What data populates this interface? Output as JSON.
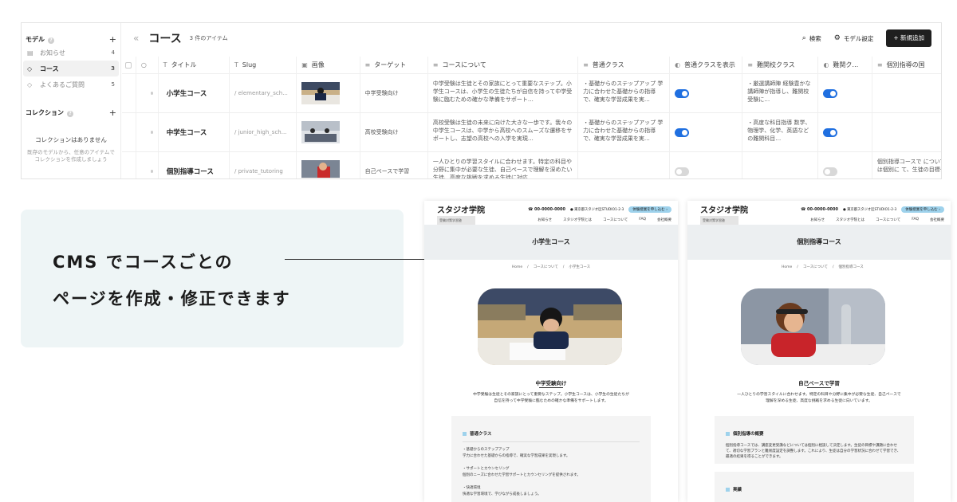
{
  "sidebar": {
    "models_label": "モデル",
    "models": [
      {
        "label": "お知らせ",
        "count": "4",
        "icon": "document-icon"
      },
      {
        "label": "コース",
        "count": "3",
        "icon": "tag-icon"
      },
      {
        "label": "よくあるご質問",
        "count": "5",
        "icon": "tag-icon"
      }
    ],
    "collections_label": "コレクション",
    "empty_title": "コレクションはありません",
    "empty_desc_1": "既存のモデルから、任意のアイテムで",
    "empty_desc_2": "コレクションを作成しましょう"
  },
  "header": {
    "back": "«",
    "title": "コース",
    "count": "3 件のアイテム",
    "search": "検索",
    "model_settings": "モデル設定",
    "new_item": "新規追加"
  },
  "table": {
    "columns": [
      "タイトル",
      "Slug",
      "画像",
      "ターゲット",
      "コースについて",
      "普通クラス",
      "普通クラスを表示",
      "難関校クラス",
      "難関ク…",
      "個別指導の国"
    ],
    "rows": [
      {
        "title": "小学生コース",
        "slug": "/ elementary_sch...",
        "target": "中学受験向け",
        "about": "中学受験は生徒とその家族にとって重要なステップ。小学生コースは、小学生の生徒たちが自信を持って中学受験に臨むための確かな準備をサポート…",
        "regular": "・基礎からのステップアップ 学力に合わせた基礎からの指導で、確実な学習成果を実…",
        "regular_show": true,
        "advanced": "・厳選講師陣 経験豊かな講師陣が指導し、難関校受験に…",
        "advanced_show": true,
        "private": ""
      },
      {
        "title": "中学生コース",
        "slug": "/ junior_high_sch...",
        "target": "高校受験向け",
        "about": "高校受験は生徒の未来に向けた大きな一歩です。我々の中学生コースは、中学から高校へのスムーズな遷移をサポートし、志望の高校への入学を実現…",
        "regular": "・基礎からのステップアップ 学力に合わせた基礎からの指導で、確実な学習成果を実…",
        "regular_show": true,
        "advanced": "・高度な科目指導 数学、物理学、化学、英語などの難関科目…",
        "advanced_show": true,
        "private": ""
      },
      {
        "title": "個別指導コース",
        "slug": "/ private_tutoring",
        "target": "自己ペースで学習",
        "about": "一人ひとりの学習スタイルに合わせます。特定の科目や分野に集中が必要な生徒、自己ペースで理解を深めたい生徒、高度な挑戦を求める生徒に対応…",
        "regular": "",
        "regular_show": false,
        "advanced": "",
        "advanced_show": false,
        "private": "個別指導コースで については個別に て、生徒の目標や"
      }
    ]
  },
  "callout": {
    "line1": "CMS でコースごとの",
    "line2": "ページを作成・修正できます"
  },
  "site": {
    "logo": "スタジオ学院",
    "logo_sub": "受験対策学習塾",
    "tel": "00-0000-0000",
    "address": "東京都スタジオ区STUDIO1-2-3",
    "cta": "体験授業を申し込む ›",
    "nav": [
      "お知らせ",
      "スタジオ学院とは",
      "コースについて",
      "FAQ",
      "会社概要"
    ],
    "crumb_home": "Home",
    "crumb_courses": "コースについて"
  },
  "preview_left": {
    "band_title": "小学生コース",
    "crumb_current": "小学生コース",
    "caption": "中学受験向け",
    "desc": "中学受験は生徒とその家族にとって重要なステップ。小学生コースは、小学生の生徒たちが自信を持って中学受験に臨むための確かな準備をサポートします。",
    "box_title": "普通クラス",
    "items": [
      {
        "h": "・基礎からのステップアップ",
        "b": "学力に合わせた基礎からの指導で、確実な学習成果を実現します。"
      },
      {
        "h": "・サポートとカウンセリング",
        "b": "個別のニーズに合わせた学習サポートとカウンセリングを提供されます。"
      },
      {
        "h": "・快適環境",
        "b": "快適な学習環境で、学びながら成長しましょう。"
      }
    ]
  },
  "preview_right": {
    "band_title": "個別指導コース",
    "crumb_current": "個別指導コース",
    "caption": "自己ペースで学習",
    "desc": "一人ひとりの学習スタイルに合わせます。特定の科目や分野に集中が必要な生徒、自己ペースで理解を深める生徒、高度な挑戦を求める生徒に向いています。",
    "box_title": "個別指導の概要",
    "box_text": "個別指導コースでは、講座変更受講などについては個別に相談して決定します。生徒の目標や課題に合わせて、適切な学習プランと難易度設定を調整します。これにより、生徒は自分の学習状況に合わせて学習でき、最適の結果を得ることができます。",
    "box2_title": "実績"
  }
}
